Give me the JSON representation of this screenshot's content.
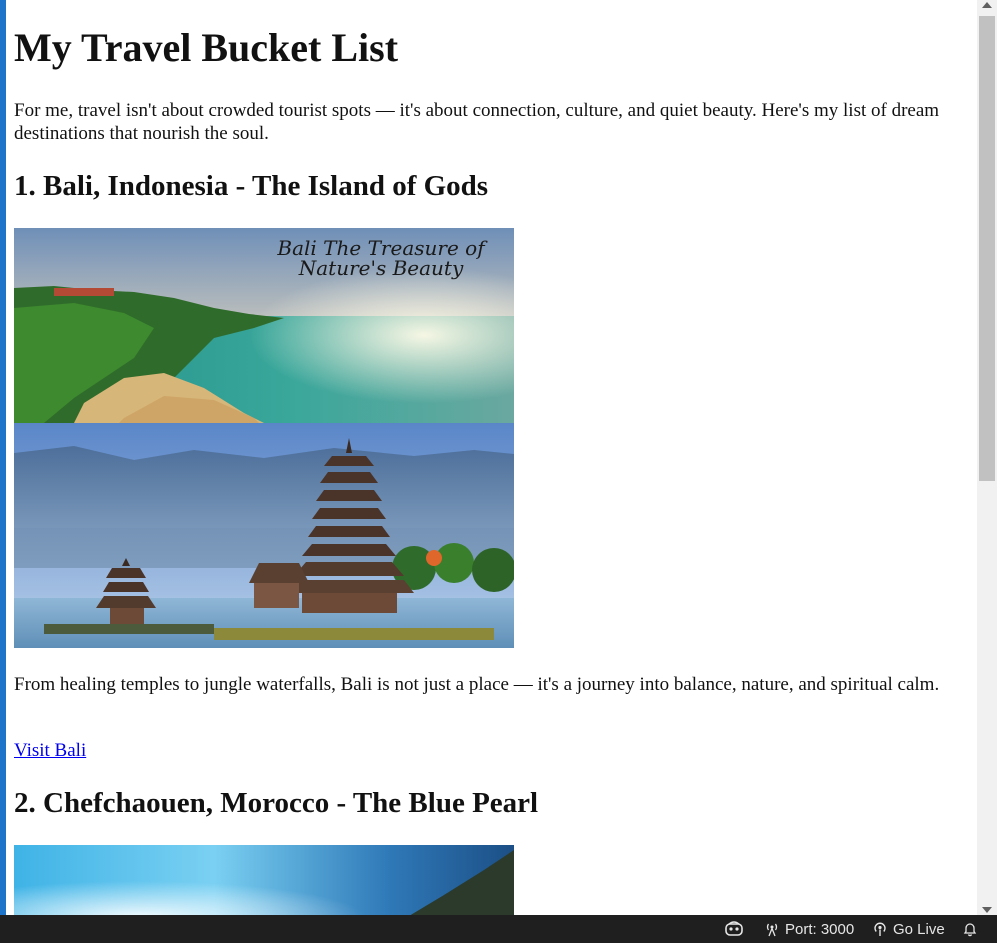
{
  "page": {
    "title": "My Travel Bucket List",
    "intro": "For me, travel isn't about crowded tourist spots — it's about connection, culture, and quiet beauty. Here's my list of dream destinations that nourish the soul."
  },
  "destinations": [
    {
      "heading": "1. Bali, Indonesia - The Island of Gods",
      "image_caption": "Bali The Treasure of Nature's Beauty",
      "description": "From healing temples to jungle waterfalls, Bali is not just a place — it's a journey into balance, nature, and spiritual calm.",
      "link": "Visit Bali"
    },
    {
      "heading": "2. Chefchaouen, Morocco - The Blue Pearl"
    }
  ],
  "statusbar": {
    "port": "Port: 3000",
    "go_live": "Go Live"
  },
  "icons": [
    "copilot-icon",
    "broadcast-icon",
    "go-live-icon",
    "bell-icon"
  ],
  "colors": {
    "link": "#0000ee",
    "accent": "#1e74c9",
    "statusbar_bg": "#1f1f1f"
  }
}
